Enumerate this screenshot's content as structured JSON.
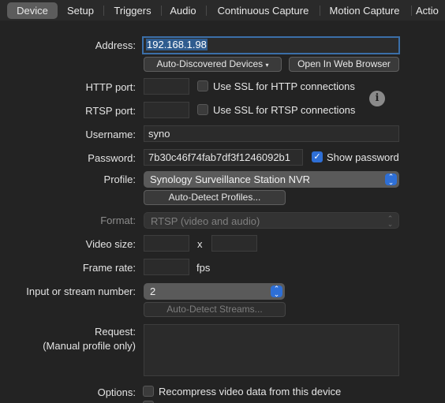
{
  "tabs": [
    {
      "label": "Device",
      "active": true
    },
    {
      "label": "Setup"
    },
    {
      "label": "Triggers"
    },
    {
      "label": "Audio"
    },
    {
      "label": "Continuous Capture"
    },
    {
      "label": "Motion Capture"
    },
    {
      "label": "Actio"
    }
  ],
  "address": {
    "label": "Address:",
    "value": "192.168.1.98"
  },
  "buttons": {
    "auto_discovered": "Auto-Discovered Devices",
    "open_web": "Open In Web Browser",
    "auto_detect_profiles": "Auto-Detect Profiles...",
    "auto_detect_streams": "Auto-Detect Streams..."
  },
  "http": {
    "label": "HTTP port:",
    "value": "",
    "ssl_label": "Use SSL for HTTP connections",
    "ssl_checked": false
  },
  "rtsp": {
    "label": "RTSP port:",
    "value": "",
    "ssl_label": "Use SSL for RTSP connections",
    "ssl_checked": false
  },
  "username": {
    "label": "Username:",
    "value": "syno"
  },
  "password": {
    "label": "Password:",
    "value": "7b30c46f74fab7df3f1246092b1",
    "show_label": "Show password",
    "show_checked": true
  },
  "profile": {
    "label": "Profile:",
    "value": "Synology Surveillance Station NVR"
  },
  "format": {
    "label": "Format:",
    "value": "RTSP (video and audio)"
  },
  "video_size": {
    "label": "Video size:",
    "width": "",
    "x": "x",
    "height": ""
  },
  "frame_rate": {
    "label": "Frame rate:",
    "value": "",
    "unit": "fps"
  },
  "stream": {
    "label": "Input or stream number:",
    "value": "2"
  },
  "request": {
    "label": "Request:",
    "sublabel": "(Manual profile only)",
    "value": ""
  },
  "options": {
    "label": "Options:",
    "recompress_label": "Recompress video data from this device",
    "recompress_checked": false
  },
  "colors": {
    "accent": "#2e6fd6",
    "background": "#232323",
    "focus_ring": "#3b6fa8"
  }
}
